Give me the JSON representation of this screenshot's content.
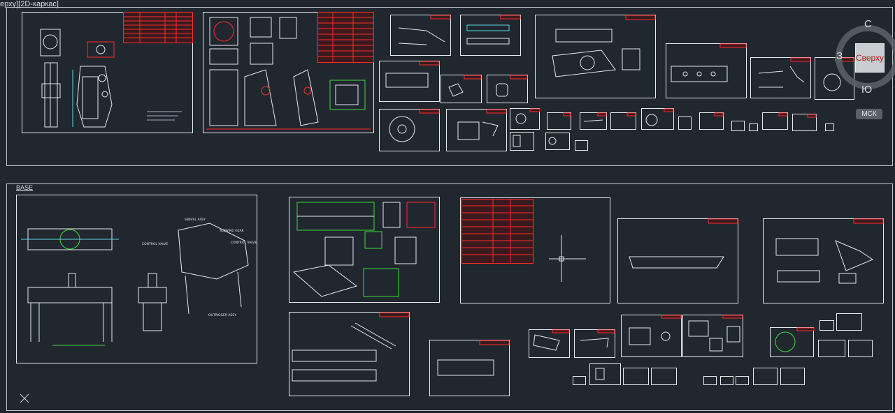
{
  "viewport": {
    "label": "ерху][2D-каркас]"
  },
  "navigation": {
    "viewcube_face": "Сверху",
    "north": "С",
    "south": "Ю",
    "west": "З",
    "wcs": "МСК"
  },
  "sections": {
    "base_title": "BASE"
  },
  "drawing_notes": {
    "swivel_assy": "SWIVEL ASSY",
    "slewing_gear": "SLEWING GEAR",
    "control_valve_left": "CONTROL VALVE",
    "control_valve_right": "CONTROL VALVE",
    "outrigger_assy": "OUTRIGGER ASSY"
  },
  "colors": {
    "background": "#21272f",
    "lines": "#e8eaec",
    "title_block": "#ff2a2a",
    "highlight": "#3cdc3c",
    "cyan": "#5ad8e6"
  }
}
